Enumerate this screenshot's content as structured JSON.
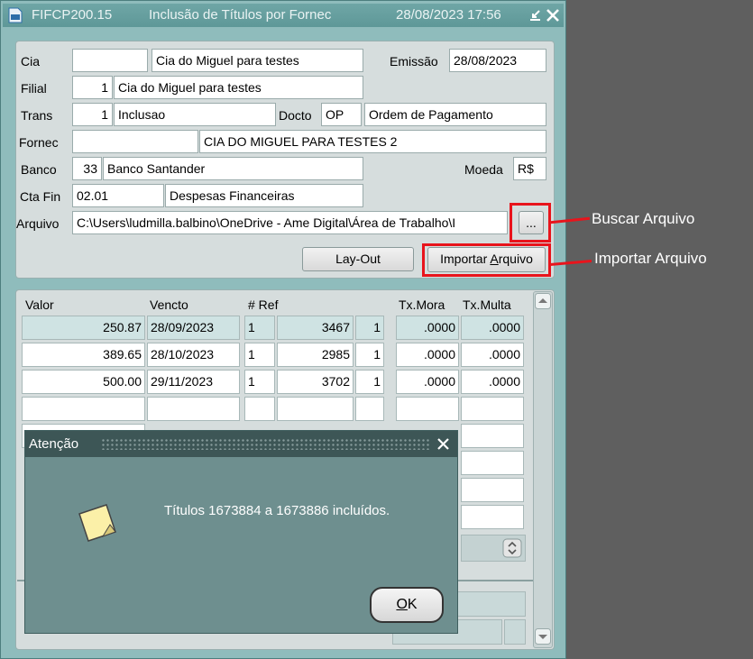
{
  "window": {
    "form_code": "FIFCP200.15",
    "title": "Inclusão de Títulos por Fornec",
    "datetime": "28/08/2023 17:56"
  },
  "header": {
    "cia_label": "Cia",
    "cia_code": "",
    "cia_name": "Cia do Miguel para testes",
    "emissao_label": "Emissão",
    "emissao_value": "28/08/2023",
    "filial_label": "Filial",
    "filial_code": "1",
    "filial_name": "Cia do Miguel para testes",
    "trans_label": "Trans",
    "trans_code": "1",
    "trans_name": "Inclusao",
    "docto_label": "Docto",
    "docto_code": "OP",
    "docto_name": "Ordem de Pagamento",
    "fornec_label": "Fornec",
    "fornec_code": "",
    "fornec_name": "CIA DO MIGUEL PARA TESTES 2",
    "banco_label": "Banco",
    "banco_code": "33",
    "banco_name": "Banco Santander",
    "moeda_label": "Moeda",
    "moeda_value": "R$",
    "ctafin_label": "Cta Fin",
    "ctafin_code": "02.01",
    "ctafin_name": "Despesas Financeiras",
    "arquivo_label": "Arquivo",
    "arquivo_path": "C:\\Users\\ludmilla.balbino\\OneDrive - Ame Digital\\Área de Trabalho\\I",
    "browse_label": "...",
    "layout_button": "Lay-Out",
    "import_button_pre": "Importar ",
    "import_button_key": "A",
    "import_button_post": "rquivo"
  },
  "grid": {
    "columns": {
      "valor": "Valor",
      "vencto": "Vencto",
      "ref": "# Ref",
      "txmora": "Tx.Mora",
      "txmulta": "Tx.Multa"
    },
    "rows": [
      {
        "valor": "250.87",
        "vencto": "28/09/2023",
        "ref1": "1",
        "ref2": "3467",
        "ref3": "1",
        "txmora": ".0000",
        "txmulta": ".0000"
      },
      {
        "valor": "389.65",
        "vencto": "28/10/2023",
        "ref1": "1",
        "ref2": "2985",
        "ref3": "1",
        "txmora": ".0000",
        "txmulta": ".0000"
      },
      {
        "valor": "500.00",
        "vencto": "29/11/2023",
        "ref1": "1",
        "ref2": "3702",
        "ref3": "1",
        "txmora": ".0000",
        "txmulta": ".0000"
      }
    ]
  },
  "dialog": {
    "title": "Atenção",
    "message": "Títulos 1673884 a 1673886 incluídos.",
    "ok_key": "O",
    "ok_rest": "K"
  },
  "annotations": {
    "buscar": "Buscar Arquivo",
    "importar": "Importar Arquivo"
  },
  "colors": {
    "highlight": "#e8141c",
    "window_bg": "#8fbcbc",
    "dialog_bg": "#6e8f8f"
  }
}
